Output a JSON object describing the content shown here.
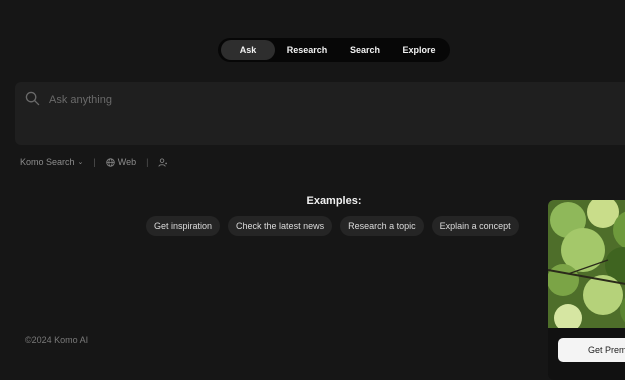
{
  "mode_tabs": [
    {
      "label": "Ask",
      "active": true
    },
    {
      "label": "Research",
      "active": false
    },
    {
      "label": "Search",
      "active": false
    },
    {
      "label": "Explore",
      "active": false
    }
  ],
  "search": {
    "placeholder": "Ask anything",
    "value": "",
    "icon": "search-icon"
  },
  "options": {
    "engine_label": "Komo Search",
    "engine_icon": "chevron-down-icon",
    "source_label": "Web",
    "source_icon": "globe-icon",
    "persona_icon": "person-icon"
  },
  "examples": {
    "title": "Examples:",
    "chips": [
      "Get inspiration",
      "Check the latest news",
      "Research a topic",
      "Explain a concept"
    ]
  },
  "footer": {
    "copyright": "©2024 Komo AI"
  },
  "promo": {
    "button_label": "Get Prem"
  },
  "colors": {
    "background": "#161616",
    "tabs_bg": "#070707",
    "tab_active": "#2e2e2e",
    "search_bg": "#1f1f1f",
    "chip_bg": "#252525"
  }
}
